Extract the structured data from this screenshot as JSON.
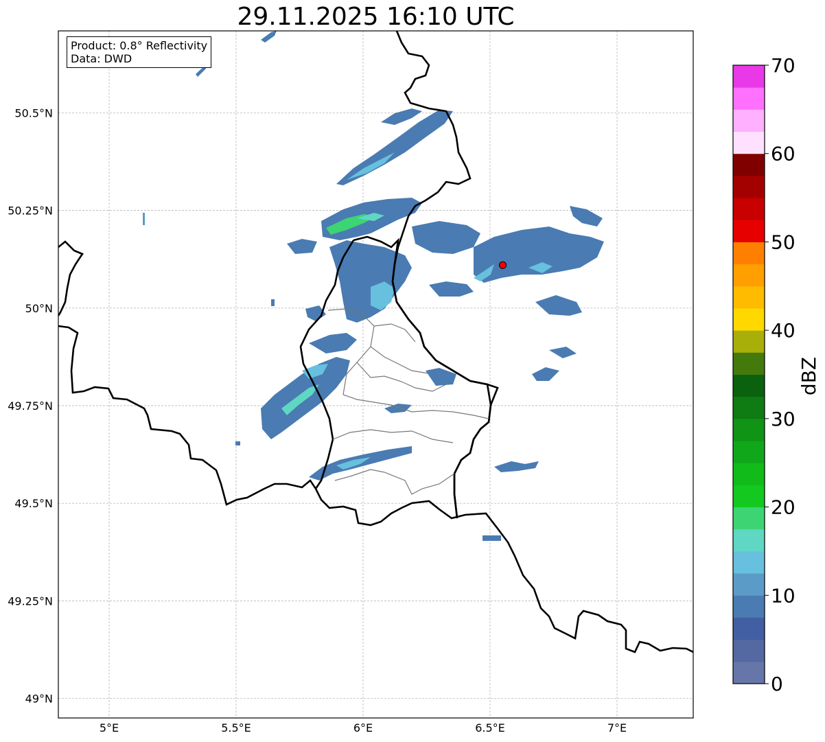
{
  "title": "29.11.2025 16:10 UTC",
  "info": {
    "product": "Product: 0.8° Reflectivity",
    "source": "Data: DWD"
  },
  "map": {
    "lon_range": [
      4.8,
      7.3
    ],
    "lat_range": [
      48.95,
      50.71
    ],
    "x_ticks": [
      {
        "value": 5.0,
        "label": "5°E"
      },
      {
        "value": 5.5,
        "label": "5.5°E"
      },
      {
        "value": 6.0,
        "label": "6°E"
      },
      {
        "value": 6.5,
        "label": "6.5°E"
      },
      {
        "value": 7.0,
        "label": "7°E"
      }
    ],
    "y_ticks": [
      {
        "value": 49.0,
        "label": "49°N"
      },
      {
        "value": 49.25,
        "label": "49.25°N"
      },
      {
        "value": 49.5,
        "label": "49.5°N"
      },
      {
        "value": 49.75,
        "label": "49.75°N"
      },
      {
        "value": 50.0,
        "label": "50°N"
      },
      {
        "value": 50.25,
        "label": "50.25°N"
      },
      {
        "value": 50.5,
        "label": "50.5°N"
      }
    ],
    "grid": true,
    "radar_site": {
      "lon": 6.55,
      "lat": 50.11,
      "color": "#ff0000"
    }
  },
  "colorbar": {
    "label": "dBZ",
    "min": 0,
    "max": 70,
    "step": 2.5,
    "tick_values": [
      0,
      10,
      20,
      30,
      40,
      50,
      60,
      70
    ],
    "tick_labels": [
      "0",
      "10",
      "20",
      "30",
      "40",
      "50",
      "60",
      "70"
    ],
    "colors": [
      "#6676a8",
      "#5468a2",
      "#425fa3",
      "#4a7bb2",
      "#5b9bc8",
      "#67c0dd",
      "#5fd7c3",
      "#3dd573",
      "#13c91f",
      "#11bb19",
      "#10a81a",
      "#0f9416",
      "#0e7c12",
      "#0a620e",
      "#447a0c",
      "#a9af09",
      "#ffd800",
      "#ffbb00",
      "#ff9f00",
      "#ff8000",
      "#e60000",
      "#c80000",
      "#a50000",
      "#800000",
      "#ffe0ff",
      "#ffb0ff",
      "#ff70ff",
      "#e838e8"
    ]
  },
  "echoes": [
    {
      "lon": 5.85,
      "lat": 50.2,
      "dbz": 18
    },
    {
      "lon": 5.95,
      "lat": 50.22,
      "dbz": 22
    },
    {
      "lon": 6.05,
      "lat": 50.24,
      "dbz": 15
    },
    {
      "lon": 6.1,
      "lat": 50.05,
      "dbz": 16
    },
    {
      "lon": 6.45,
      "lat": 50.1,
      "dbz": 14
    },
    {
      "lon": 5.7,
      "lat": 49.78,
      "dbz": 14
    },
    {
      "lon": 5.65,
      "lat": 49.72,
      "dbz": 18
    },
    {
      "lon": 6.0,
      "lat": 49.6,
      "dbz": 12
    }
  ]
}
